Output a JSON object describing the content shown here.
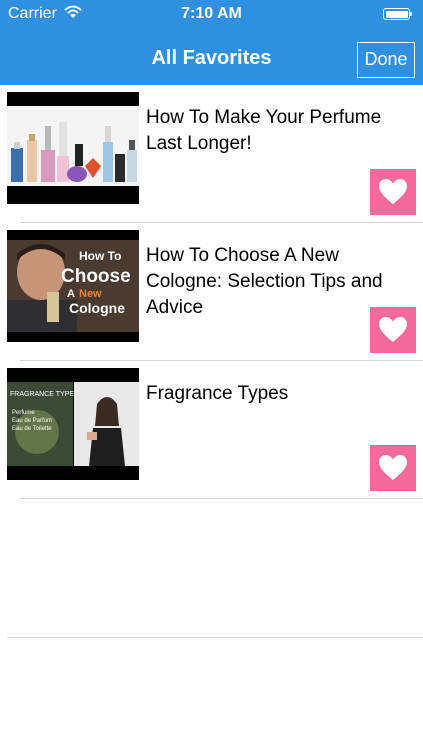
{
  "status": {
    "carrier": "Carrier",
    "time": "7:10 AM",
    "battery_level": 1.0
  },
  "nav": {
    "title": "All Favorites",
    "done_label": "Done"
  },
  "colors": {
    "bar": "#2f8fe0",
    "heart": "#f66a9b"
  },
  "items": [
    {
      "title": "How To Make Your Perfume Last Longer!"
    },
    {
      "title": "How To Choose A New Cologne: Selection Tips and Advice",
      "thumb_text": {
        "line1": "How To",
        "line2": "Choose",
        "line3a": "A",
        "line3b": "New",
        "line4": "Cologne"
      }
    },
    {
      "title": "Fragrance Types",
      "thumb_text": {
        "heading": "FRAGRANCE TYPES",
        "bullet1": "Perfume",
        "bullet2": "Eau de Parfum",
        "bullet3": "Eau de Toilette"
      }
    }
  ]
}
